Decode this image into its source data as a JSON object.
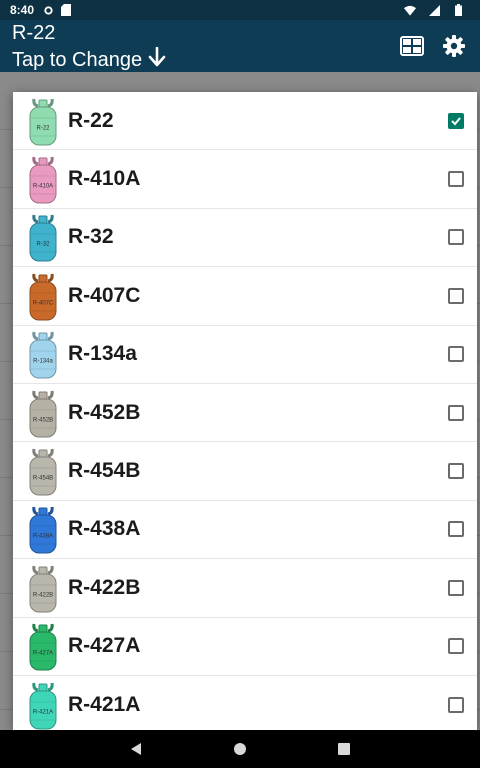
{
  "status_bar": {
    "time": "8:40"
  },
  "app_bar": {
    "title": "R-22",
    "subtitle": "Tap to Change"
  },
  "refrigerants": [
    {
      "name": "R-22",
      "color": "#8fdcb0",
      "selected": true
    },
    {
      "name": "R-410A",
      "color": "#e89ac0",
      "selected": false
    },
    {
      "name": "R-32",
      "color": "#3fb3cc",
      "selected": false
    },
    {
      "name": "R-407C",
      "color": "#c96a2a",
      "selected": false
    },
    {
      "name": "R-134a",
      "color": "#9fd4ec",
      "selected": false
    },
    {
      "name": "R-452B",
      "color": "#b5b1a5",
      "selected": false
    },
    {
      "name": "R-454B",
      "color": "#b9b6ac",
      "selected": false
    },
    {
      "name": "R-438A",
      "color": "#2f78d8",
      "selected": false
    },
    {
      "name": "R-422B",
      "color": "#b9b6ac",
      "selected": false
    },
    {
      "name": "R-427A",
      "color": "#2ab86a",
      "selected": false
    },
    {
      "name": "R-421A",
      "color": "#3fd6b8",
      "selected": false
    }
  ],
  "colors": {
    "status_bar": "#0d3143",
    "app_bar": "#0e3c55",
    "checkbox_checked": "#007c66"
  }
}
